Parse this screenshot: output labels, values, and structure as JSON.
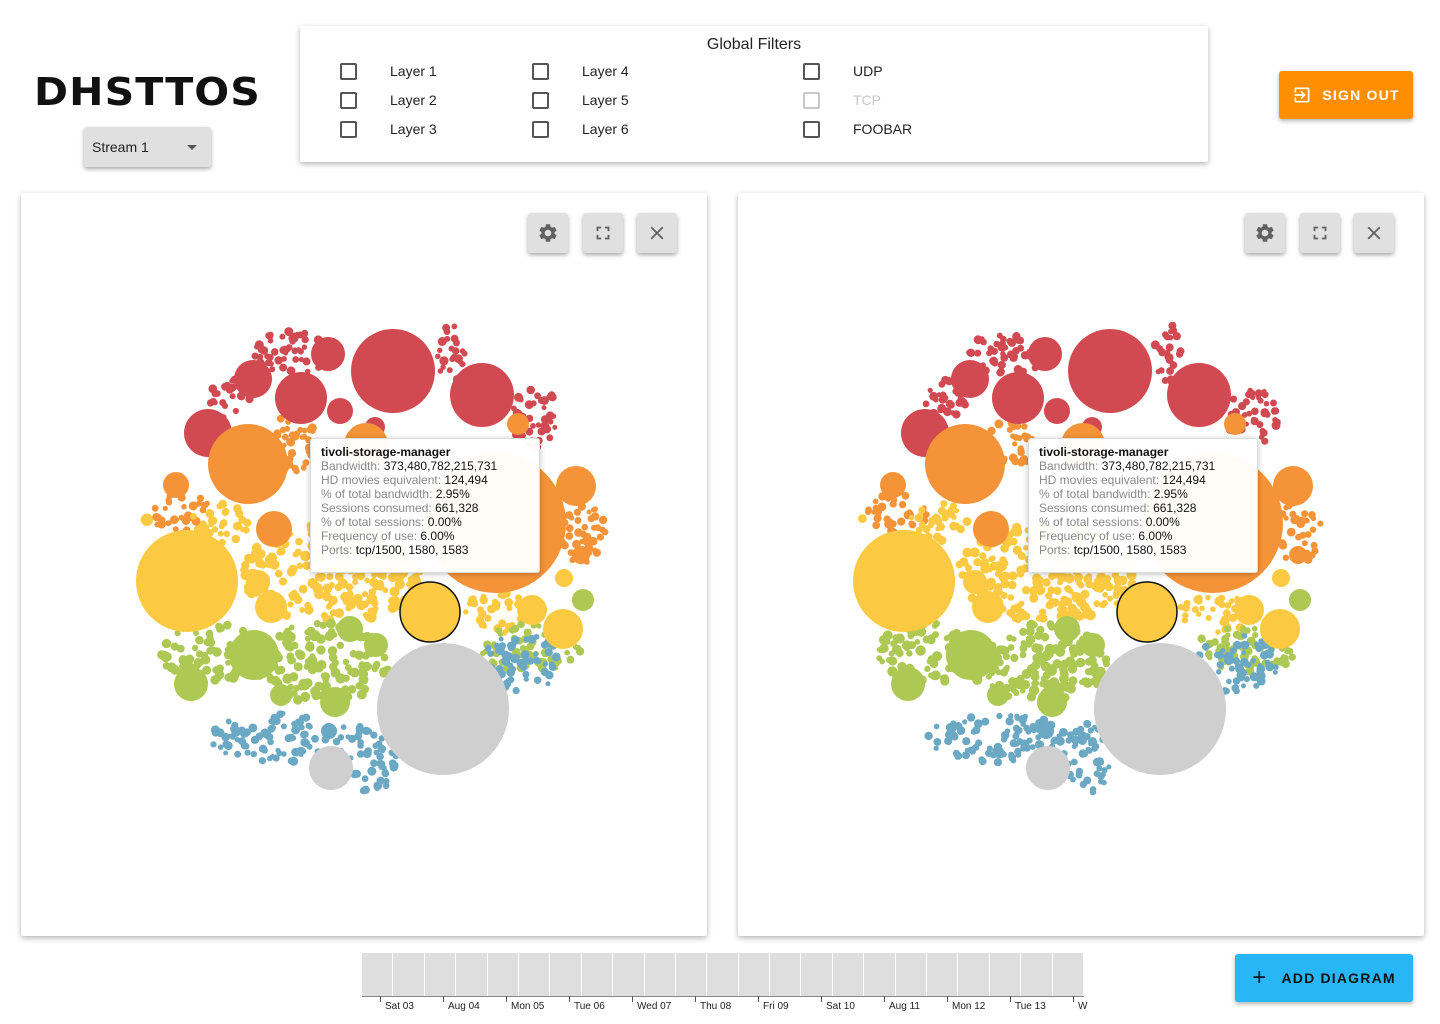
{
  "header": {
    "logo": "DHSTTOS",
    "stream_select": {
      "value": "Stream 1"
    },
    "sign_out_label": "SIGN OUT"
  },
  "filters": {
    "title": "Global Filters",
    "options": [
      {
        "label": "Layer 1",
        "checked": false,
        "disabled": false
      },
      {
        "label": "Layer 2",
        "checked": false,
        "disabled": false
      },
      {
        "label": "Layer 3",
        "checked": false,
        "disabled": false
      },
      {
        "label": "Layer 4",
        "checked": false,
        "disabled": false
      },
      {
        "label": "Layer 5",
        "checked": false,
        "disabled": false
      },
      {
        "label": "Layer 6",
        "checked": false,
        "disabled": false
      },
      {
        "label": "UDP",
        "checked": false,
        "disabled": false
      },
      {
        "label": "TCP",
        "checked": false,
        "disabled": true
      },
      {
        "label": "FOOBAR",
        "checked": false,
        "disabled": false
      }
    ]
  },
  "panels": [
    {
      "buttons": {
        "settings_icon": "gear-icon",
        "fullscreen_icon": "fullscreen-icon",
        "close_icon": "close-icon"
      },
      "tooltip": {
        "title": "tivoli-storage-manager",
        "rows": [
          {
            "key": "Bandwidth:",
            "value": "373,480,782,215,731"
          },
          {
            "key": "HD movies equivalent:",
            "value": "124,494"
          },
          {
            "key": "% of total bandwidth:",
            "value": "2.95%"
          },
          {
            "key": "Sessions consumed:",
            "value": "661,328"
          },
          {
            "key": "% of total sessions:",
            "value": "0.00%"
          },
          {
            "key": "Frequency of use:",
            "value": "6.00%"
          },
          {
            "key": "Ports:",
            "value": "tcp/1500, 1580, 1583"
          }
        ]
      }
    },
    {
      "buttons": {
        "settings_icon": "gear-icon",
        "fullscreen_icon": "fullscreen-icon",
        "close_icon": "close-icon"
      },
      "tooltip": {
        "title": "tivoli-storage-manager",
        "rows": [
          {
            "key": "Bandwidth:",
            "value": "373,480,782,215,731"
          },
          {
            "key": "HD movies equivalent:",
            "value": "124,494"
          },
          {
            "key": "% of total bandwidth:",
            "value": "2.95%"
          },
          {
            "key": "Sessions consumed:",
            "value": "661,328"
          },
          {
            "key": "% of total sessions:",
            "value": "0.00%"
          },
          {
            "key": "Frequency of use:",
            "value": "6.00%"
          },
          {
            "key": "Ports:",
            "value": "tcp/1500, 1580, 1583"
          }
        ]
      }
    }
  ],
  "colors": {
    "red": "#d14a52",
    "orange": "#f59338",
    "yellow": "#fcca42",
    "green": "#adc853",
    "blue": "#6aa8c4",
    "gray": "#cfcfcf",
    "sign_out_bg": "#ff8f00",
    "add_diagram_bg": "#29b6f6"
  },
  "timeline": {
    "labels": [
      "Sat 03",
      "Aug 04",
      "Mon 05",
      "Tue 06",
      "Wed 07",
      "Thu 08",
      "Fri 09",
      "Sat 10",
      "Aug 11",
      "Mon 12",
      "Tue 13",
      "W"
    ]
  },
  "add_diagram_label": "ADD DIAGRAM"
}
